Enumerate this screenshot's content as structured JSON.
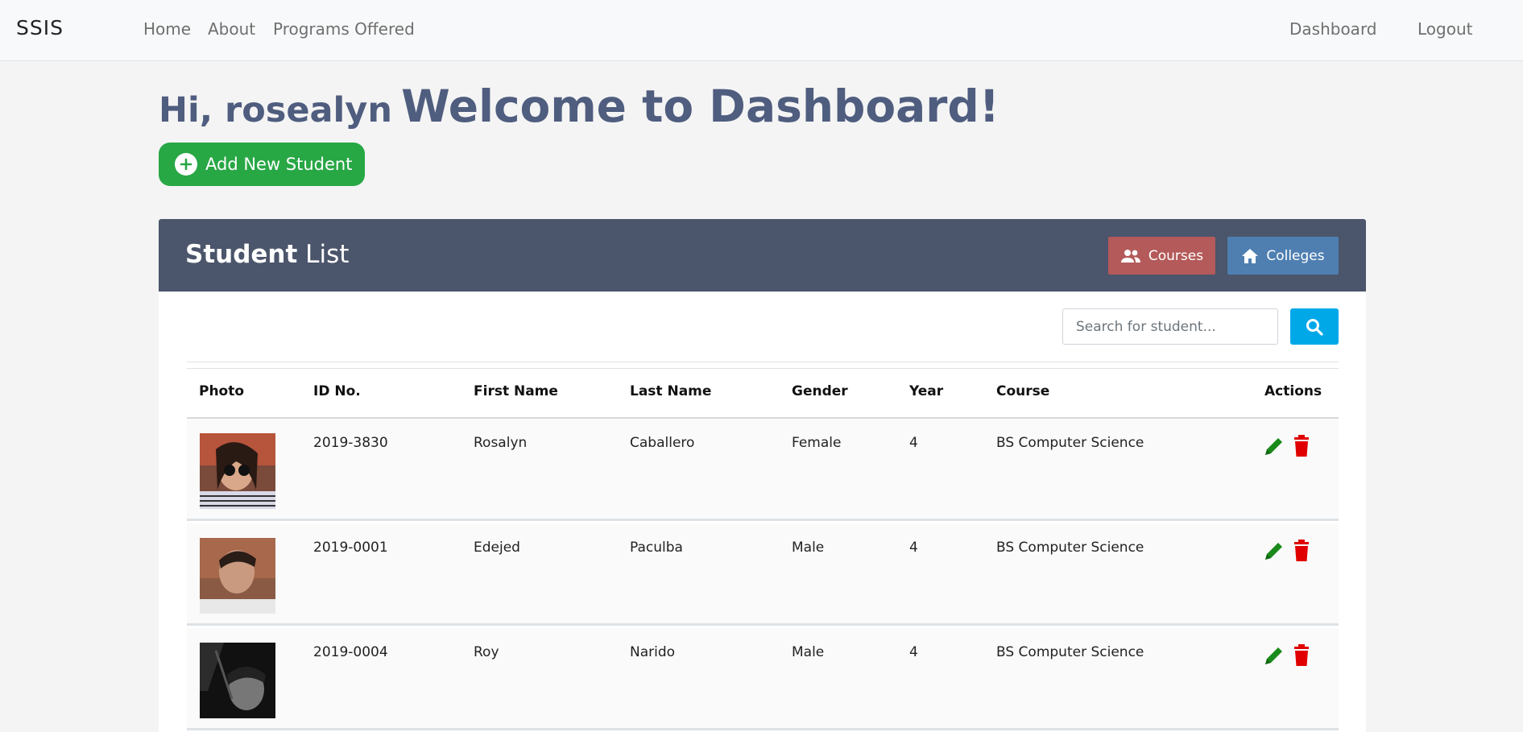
{
  "navbar": {
    "brand": "SSIS",
    "links": [
      "Home",
      "About",
      "Programs Offered"
    ],
    "right_links": [
      "Dashboard",
      "Logout"
    ]
  },
  "greeting": {
    "hi": "Hi, rosealyn",
    "welcome": "Welcome to Dashboard!"
  },
  "add_button": "Add New Student",
  "card": {
    "title_bold": "Student",
    "title_rest": " List",
    "courses_label": "Courses",
    "colleges_label": "Colleges"
  },
  "search": {
    "placeholder": "Search for student..."
  },
  "table": {
    "headers": [
      "Photo",
      "ID No.",
      "First Name",
      "Last Name",
      "Gender",
      "Year",
      "Course",
      "Actions"
    ],
    "rows": [
      {
        "id": "2019-3830",
        "first": "Rosalyn",
        "last": "Caballero",
        "gender": "Female",
        "year": "4",
        "course": "BS Computer Science"
      },
      {
        "id": "2019-0001",
        "first": "Edejed",
        "last": "Paculba",
        "gender": "Male",
        "year": "4",
        "course": "BS Computer Science"
      },
      {
        "id": "2019-0004",
        "first": "Roy",
        "last": "Narido",
        "gender": "Male",
        "year": "4",
        "course": "BS Computer Science"
      }
    ]
  },
  "colors": {
    "navbar_bg": "#f8f9fa",
    "heading": "#4f5d7f",
    "add_button": "#28a745",
    "card_header": "#4b556b",
    "courses_button": "#b45a5a",
    "colleges_button": "#4f7fb1",
    "search_button": "#00a8e8",
    "edit_icon": "#1a8a1a",
    "delete_icon": "#e00000"
  },
  "icons": {
    "add": "plus-circle-icon",
    "courses": "people-icon",
    "colleges": "home-icon",
    "search": "search-icon",
    "edit": "pencil-icon",
    "delete": "trash-icon"
  }
}
